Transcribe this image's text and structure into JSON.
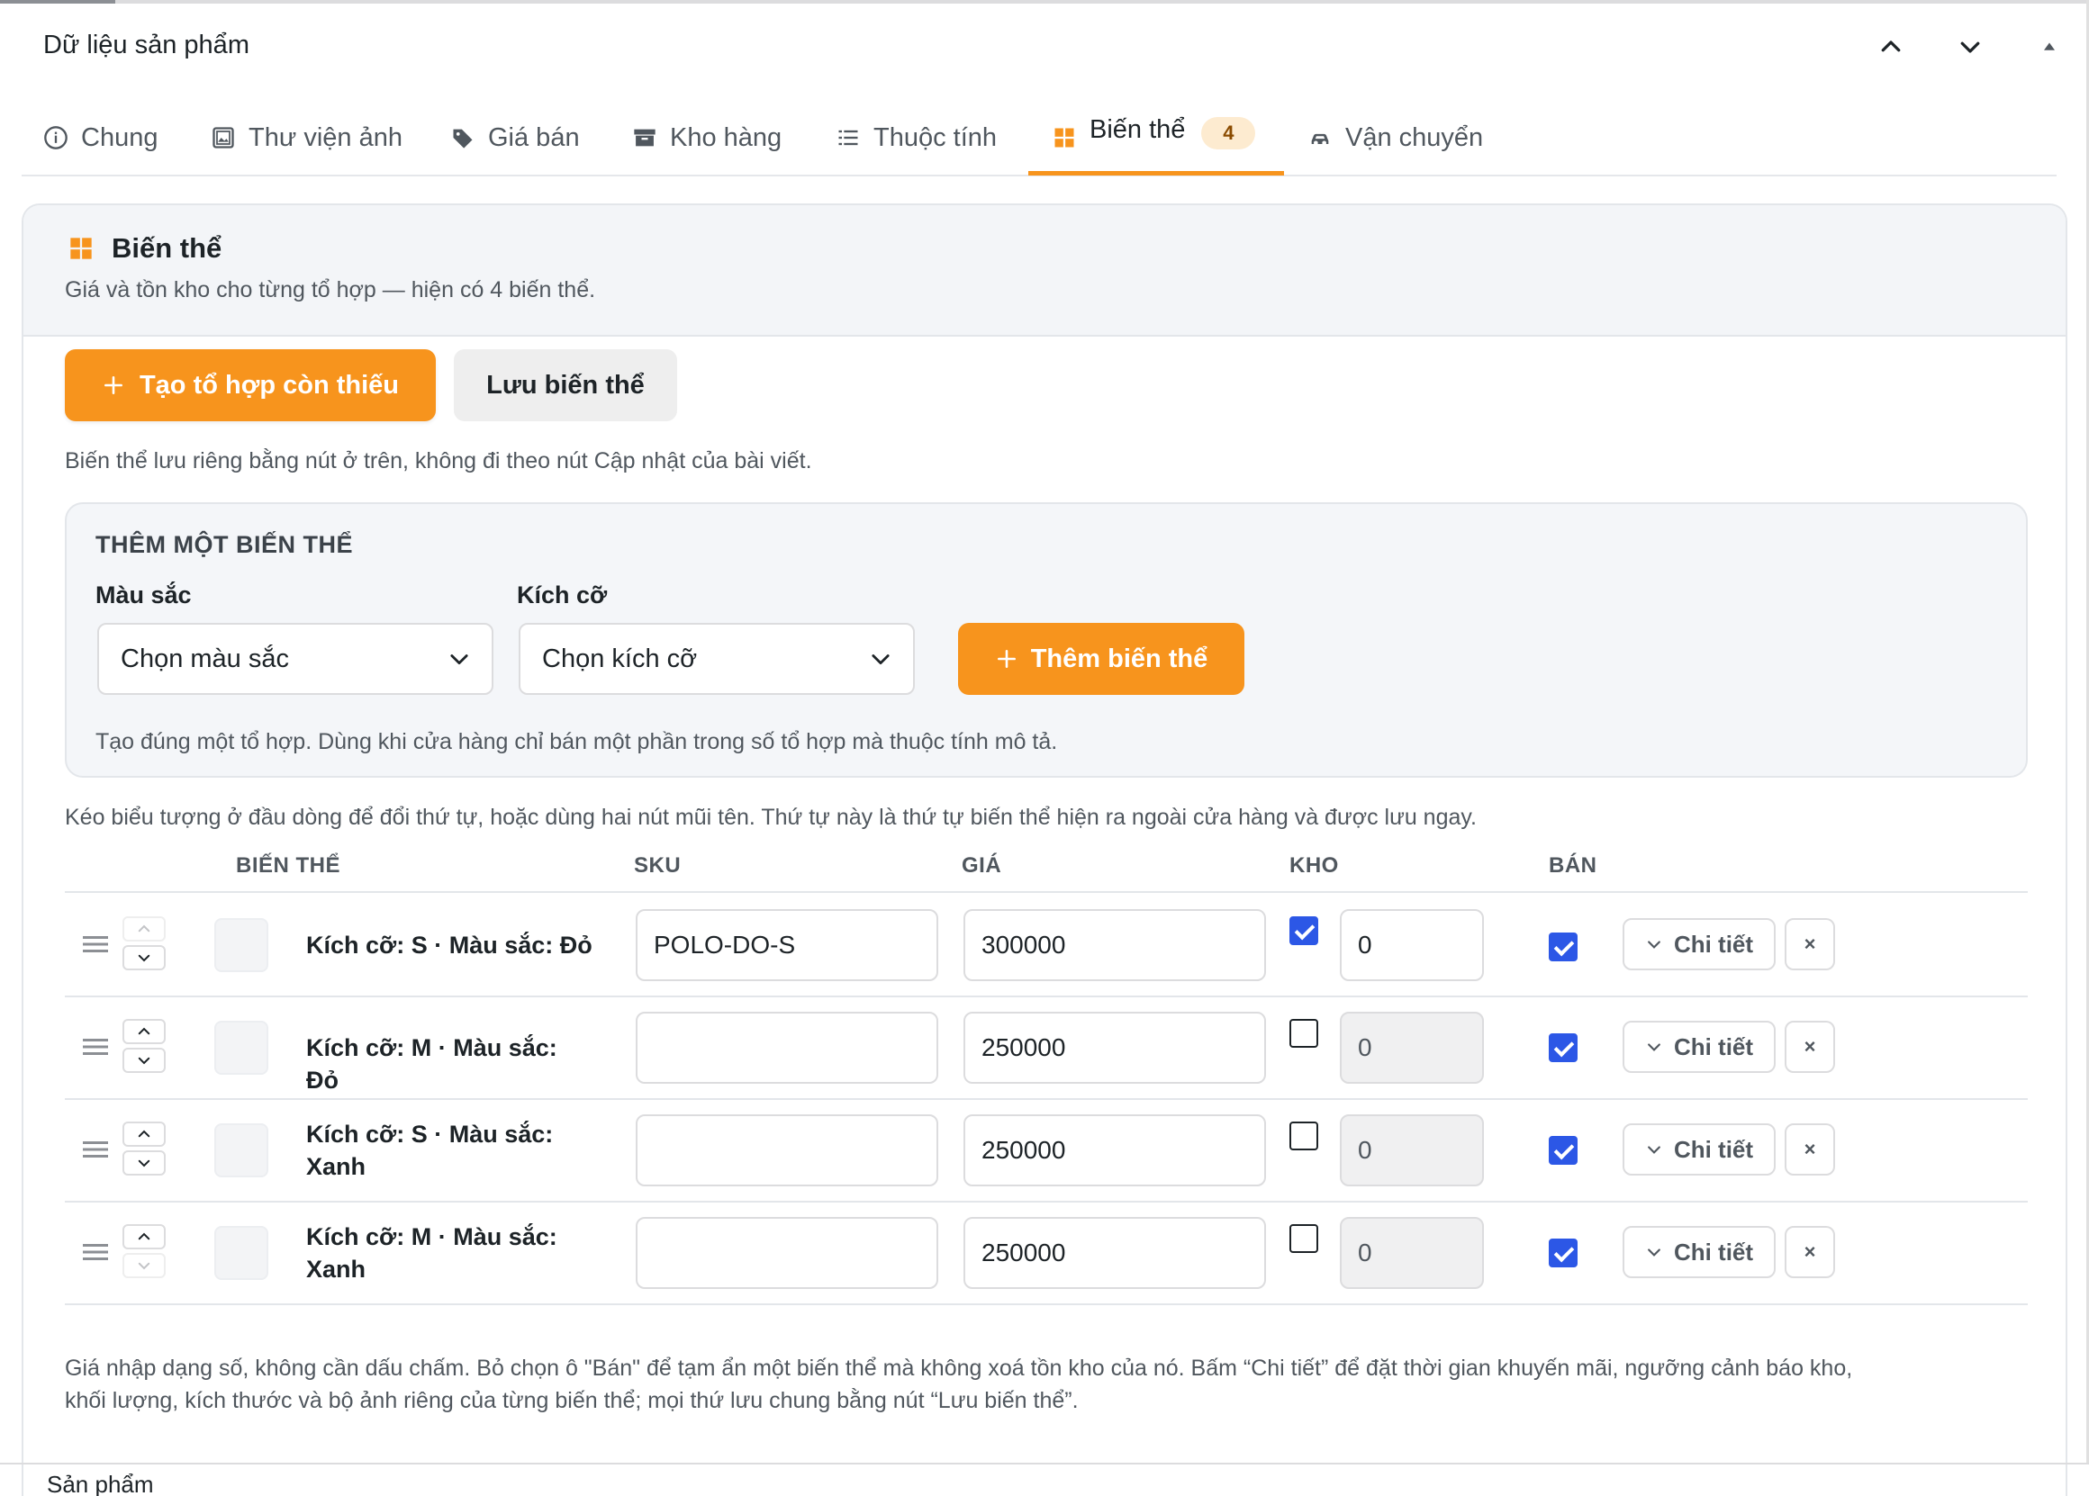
{
  "panel": {
    "title": "Dữ liệu sản phẩm"
  },
  "tabs": [
    {
      "label": "Chung",
      "icon": "info-icon"
    },
    {
      "label": "Thư viện ảnh",
      "icon": "gallery-icon"
    },
    {
      "label": "Giá bán",
      "icon": "tag-icon"
    },
    {
      "label": "Kho hàng",
      "icon": "archive-icon"
    },
    {
      "label": "Thuộc tính",
      "icon": "list-icon"
    },
    {
      "label": "Biến thể",
      "icon": "grid-icon",
      "badge": "4",
      "active": true
    },
    {
      "label": "Vận chuyển",
      "icon": "car-icon"
    }
  ],
  "variants_section": {
    "title": "Biến thể",
    "subtitle": "Giá và tồn kho cho từng tổ hợp — hiện có 4 biến thể.",
    "create_missing_label": "Tạo tổ hợp còn thiếu",
    "save_label": "Lưu biến thể",
    "save_note": "Biến thể lưu riêng bằng nút ở trên, không đi theo nút Cập nhật của bài viết."
  },
  "add_variant": {
    "title": "THÊM MỘT BIẾN THỂ",
    "color_label": "Màu sắc",
    "color_value": "Chọn màu sắc",
    "size_label": "Kích cỡ",
    "size_value": "Chọn kích cỡ",
    "add_label": "Thêm biến thể",
    "hint": "Tạo đúng một tổ hợp. Dùng khi cửa hàng chỉ bán một phần trong số tổ hợp mà thuộc tính mô tả."
  },
  "order_note": "Kéo biểu tượng ở đầu dòng để đổi thứ tự, hoặc dùng hai nút mũi tên. Thứ tự này là thứ tự biến thể hiện ra ngoài cửa hàng và được lưu ngay.",
  "table": {
    "headers": {
      "variant": "BIẾN THỂ",
      "sku": "SKU",
      "price": "GIÁ",
      "stock": "KHO",
      "sell": "BÁN"
    },
    "detail_label": "Chi tiết",
    "delete_label": "×",
    "rows": [
      {
        "line1": "Kích cỡ: S · Màu sắc: Đỏ",
        "line2": "",
        "sku": "POLO-DO-S",
        "price": "300000",
        "manage_stock": true,
        "stock": "0",
        "sell": true
      },
      {
        "line1": "Kích cỡ: M · Màu sắc: Đỏ",
        "line2": "",
        "sku": "",
        "price": "250000",
        "manage_stock": false,
        "stock": "0",
        "sell": true
      },
      {
        "line1": "Kích cỡ: S · Màu sắc:",
        "line2": "Xanh",
        "sku": "",
        "price": "250000",
        "manage_stock": false,
        "stock": "0",
        "sell": true
      },
      {
        "line1": "Kích cỡ: M · Màu sắc:",
        "line2": "Xanh",
        "sku": "",
        "price": "250000",
        "manage_stock": false,
        "stock": "0",
        "sell": true
      }
    ]
  },
  "footer_note_line1": "Giá nhập dạng số, không cần dấu chấm. Bỏ chọn ô \"Bán\" để tạm ẩn một biến thể mà không xoá tồn kho của nó. Bấm “Chi tiết” để đặt thời gian khuyến mãi, ngưỡng cảnh báo kho,",
  "footer_note_line2": "khối lượng, kích thước và bộ ảnh riêng của từng biến thể; mọi thứ lưu chung bằng nút “Lưu biến thể”.",
  "bottom_label": "Sản phẩm",
  "colors": {
    "accent": "#f7941d",
    "checkbox": "#2c57e6"
  }
}
